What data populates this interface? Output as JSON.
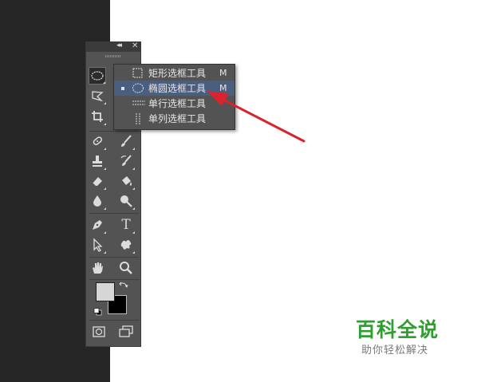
{
  "flyout": {
    "items": [
      {
        "label": "矩形选框工具",
        "shortcut": "M",
        "icon": "rect-marquee-icon",
        "selected": false
      },
      {
        "label": "椭圆选框工具",
        "shortcut": "M",
        "icon": "ellipse-marquee-icon",
        "selected": true
      },
      {
        "label": "单行选框工具",
        "shortcut": "",
        "icon": "single-row-marquee-icon",
        "selected": false
      },
      {
        "label": "单列选框工具",
        "shortcut": "",
        "icon": "single-column-marquee-icon",
        "selected": false
      }
    ]
  },
  "toolbar": {
    "tools": [
      "ellipse-marquee-icon",
      "lasso-icon",
      "crop-icon",
      "healing-brush-icon",
      "brush-icon",
      "clone-stamp-icon",
      "history-brush-icon",
      "eraser-icon",
      "paint-bucket-icon",
      "blur-icon",
      "dodge-icon",
      "pen-icon",
      "type-icon",
      "path-selection-icon",
      "shape-icon",
      "hand-icon",
      "zoom-icon",
      "quick-mask-icon",
      "screen-mode-icon"
    ],
    "type_glyph": "T"
  },
  "colors": {
    "foreground": "#d6d6d6",
    "background": "#000000",
    "panel": "#535353",
    "highlight": "#4a5f80",
    "arrow": "#d9232e"
  },
  "watermark": {
    "title": "百科全说",
    "subtitle": "助你轻松解决"
  }
}
